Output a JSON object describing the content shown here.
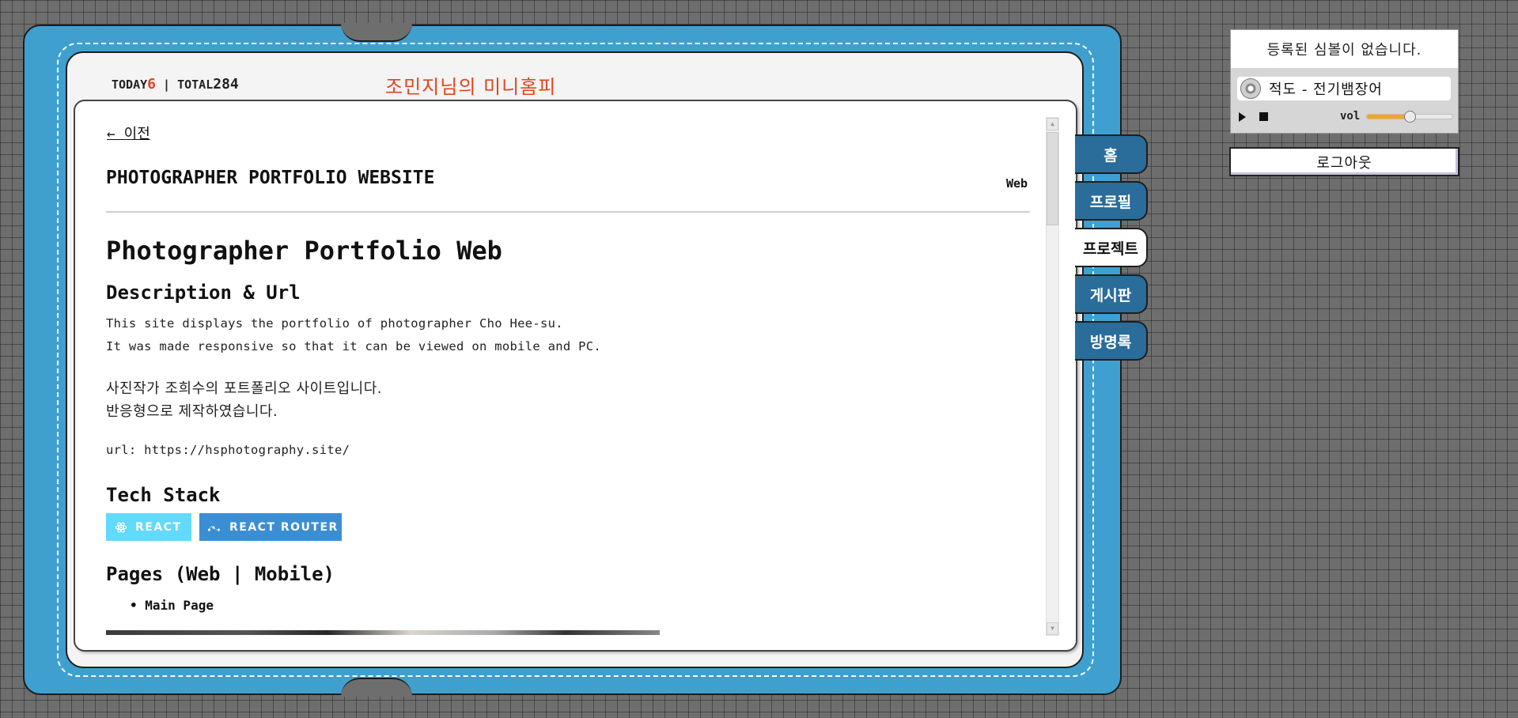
{
  "header": {
    "today_label": "TODAY",
    "today_count": "6",
    "separator": "|",
    "total_label": "TOTAL",
    "total_count": "284",
    "site_title": "조민지님의 미니홈피"
  },
  "post": {
    "back_label": "← 이전",
    "title": "PHOTOGRAPHER PORTFOLIO WEBSITE",
    "category": "Web",
    "heading": "Photographer Portfolio Web",
    "section_desc": "Description & Url",
    "desc_en_1": "This site displays the portfolio of photographer Cho Hee-su.",
    "desc_en_2": "It was made responsive so that it can be viewed on mobile and PC.",
    "desc_ko_1": "사진작가 조희수의 포트폴리오 사이트입니다.",
    "desc_ko_2": "반응형으로 제작하였습니다.",
    "url_line": "url: https://hsphotography.site/",
    "section_tech": "Tech Stack",
    "tech_badges": [
      "REACT",
      "REACT ROUTER"
    ],
    "section_pages": "Pages (Web | Mobile)",
    "pages": [
      "Main Page"
    ]
  },
  "tabs": [
    {
      "label": "홈",
      "active": false
    },
    {
      "label": "프로필",
      "active": false
    },
    {
      "label": "프로젝트",
      "active": true
    },
    {
      "label": "게시판",
      "active": false
    },
    {
      "label": "방명록",
      "active": false
    }
  ],
  "sidebar": {
    "symbol_message": "등록된 심볼이 없습니다.",
    "song": "적도 - 전기뱀장어",
    "vol_label": "vol",
    "volume": 0.5,
    "logout_label": "로그아웃"
  },
  "colors": {
    "book_blue": "#3fa0cf",
    "tab_blue": "#2a6c9a",
    "accent_red": "#e3441e",
    "react_badge": "#61dafb",
    "router_badge": "#3a8fd4",
    "volume_fill": "#f3a71a"
  }
}
